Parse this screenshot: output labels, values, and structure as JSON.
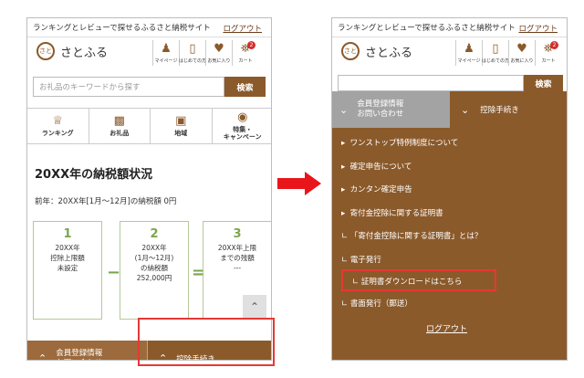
{
  "header": {
    "tagline": "ランキングとレビューで探せるふるさと納税サイト",
    "logout": "ログアウト",
    "logo_mark": "さと",
    "logo_text": "さとふる",
    "nav": [
      {
        "label": "マイページ",
        "icon": "person-icon"
      },
      {
        "label": "はじめての方",
        "icon": "book-icon"
      },
      {
        "label": "お気に入り",
        "icon": "heart-icon"
      },
      {
        "label": "カート",
        "icon": "cart-icon",
        "badge": "2"
      }
    ]
  },
  "search": {
    "placeholder": "お礼品のキーワードから探す",
    "button": "検索"
  },
  "categories": [
    {
      "label": "ランキング",
      "icon": "crown-icon"
    },
    {
      "label": "お礼品",
      "icon": "gift-icon"
    },
    {
      "label": "地域",
      "icon": "region-icon"
    },
    {
      "label": "特集・\nキャンペーン",
      "icon": "medal-icon"
    }
  ],
  "summary": {
    "title": "20XX年の納税額状況",
    "subtitle": "前年：20XX年[1月〜12月]の納税額 0円",
    "boxes": [
      {
        "num": "1",
        "text": "20XX年\n控除上限額\n未設定"
      },
      {
        "num": "2",
        "text": "20XX年\n(1月〜12月)\nの納税額\n252,000円"
      },
      {
        "num": "3",
        "text": "20XX年上限\nまでの残額\n---",
        "bold": "残額"
      }
    ],
    "ops": [
      "−",
      "="
    ]
  },
  "bottom_bar": {
    "member": "会員登録情報\nお問い合わせ",
    "procedure": "控除手続き"
  },
  "menu": {
    "member_tab": "会員登録情報\nお問い合わせ",
    "procedure_tab": "控除手続き",
    "items": [
      "ワンストップ特例制度について",
      "確定申告について",
      "カンタン確定申告",
      "寄付金控除に関する証明書",
      "「寄付金控除に関する証明書」とは？",
      "電子発行",
      "証明書ダウンロードはこちら",
      "書面発行（郵送）"
    ],
    "logout": "ログアウト"
  },
  "colors": {
    "brand": "#8b5a2b",
    "accent_green": "#7aa64b",
    "highlight": "#e53935"
  }
}
